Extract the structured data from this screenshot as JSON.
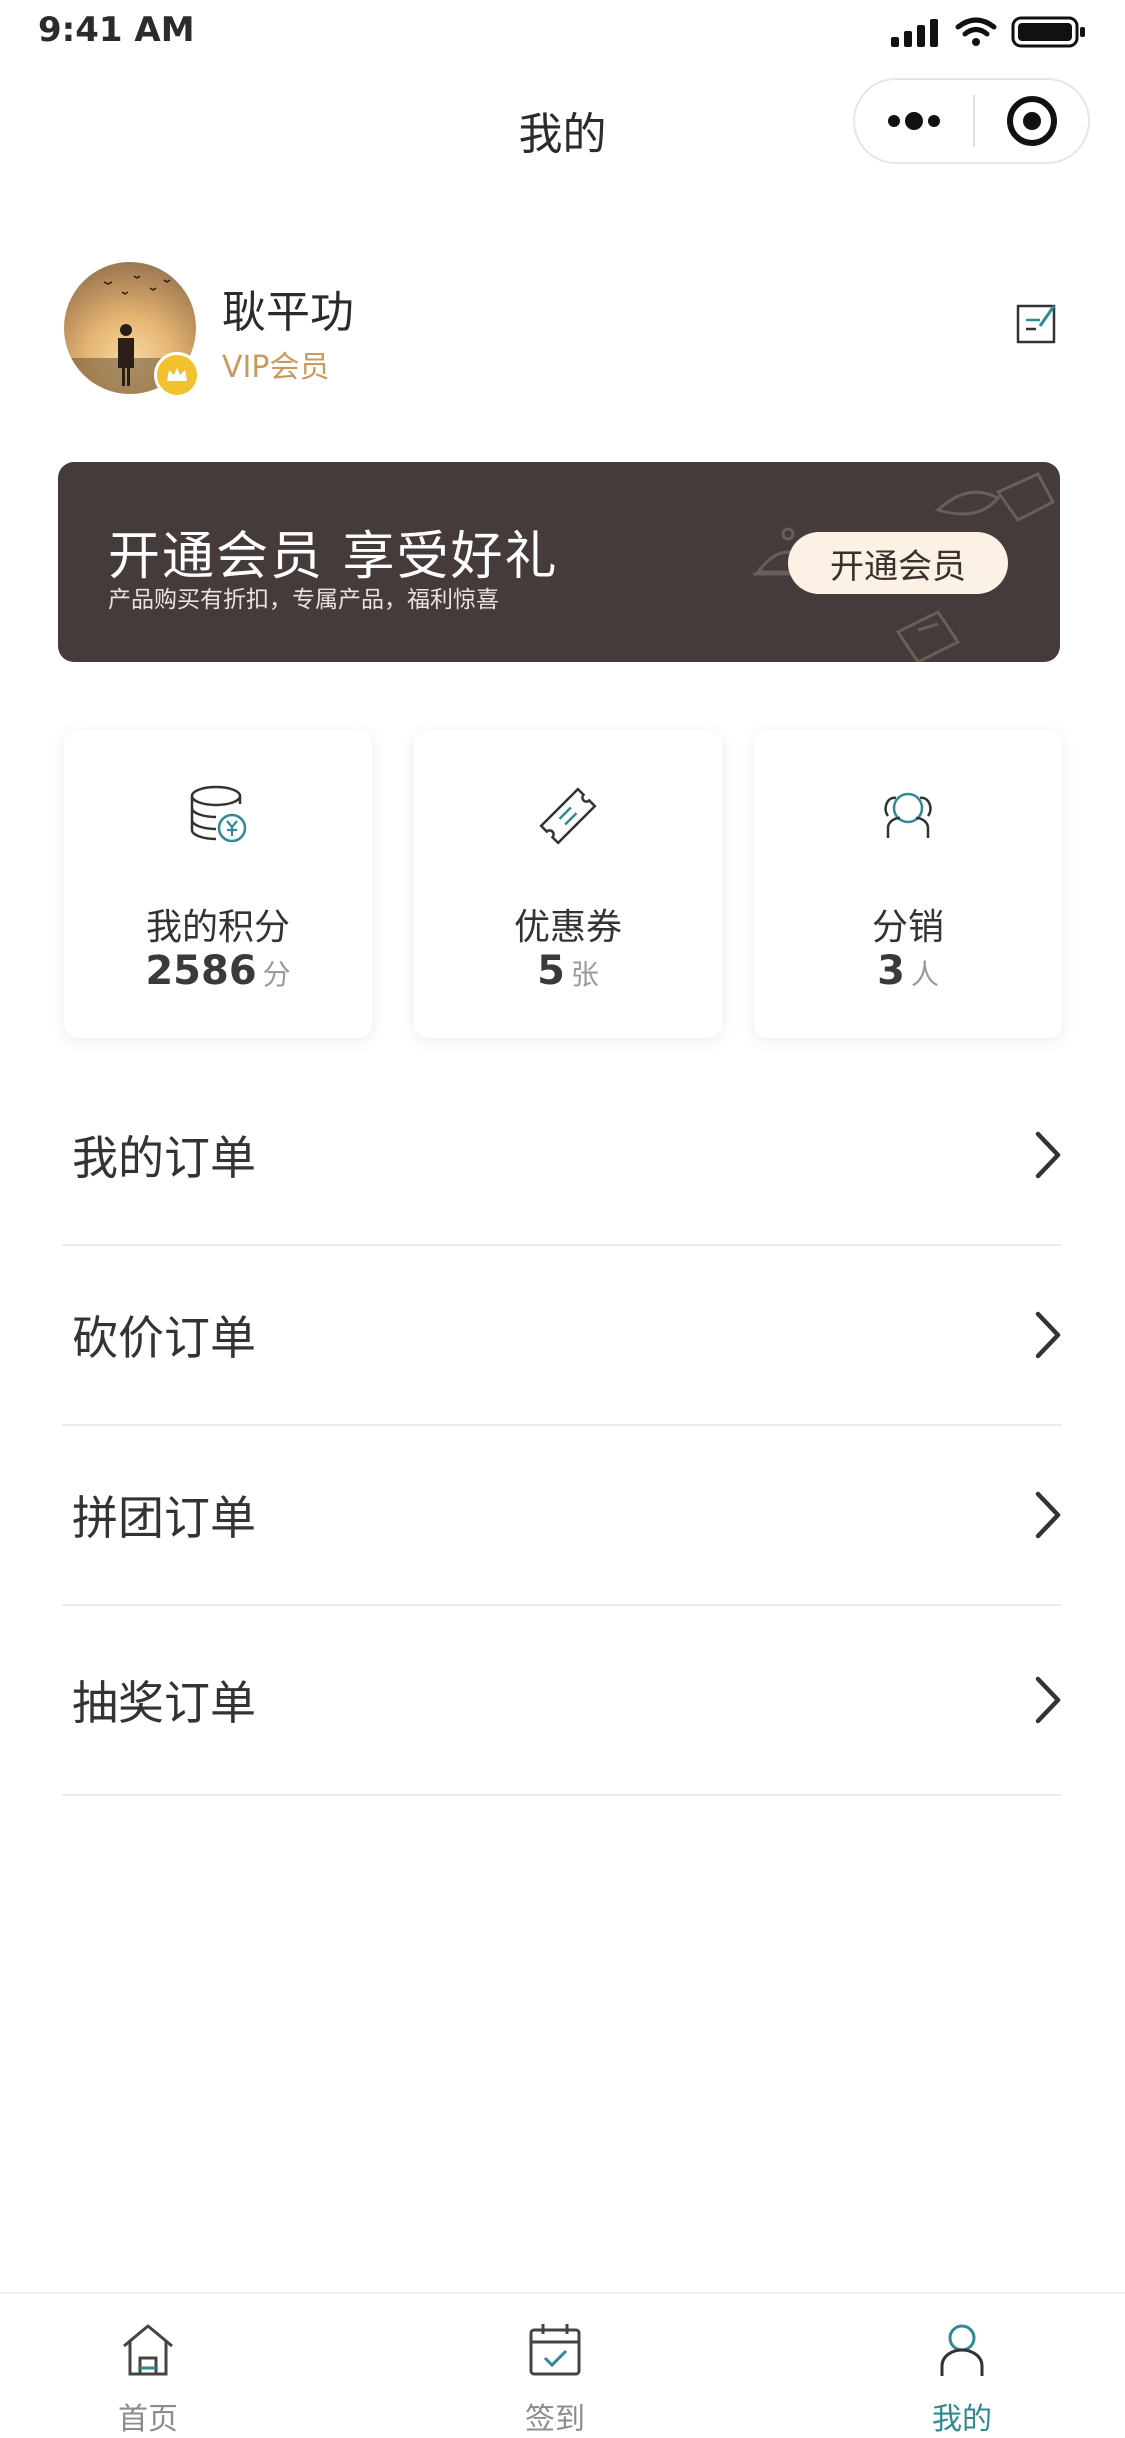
{
  "status_bar": {
    "time": "9:41 AM"
  },
  "header": {
    "title": "我的"
  },
  "profile": {
    "name": "耿平功",
    "badge": "VIP会员"
  },
  "vip_banner": {
    "title": "开通会员 享受好礼",
    "subtitle": "产品购买有折扣，专属产品，福利惊喜",
    "button_label": "开通会员"
  },
  "stats": [
    {
      "label": "我的积分",
      "value": "2586",
      "unit": "分",
      "icon": "coins-icon"
    },
    {
      "label": "优惠券",
      "value": "5",
      "unit": "张",
      "icon": "coupon-icon"
    },
    {
      "label": "分销",
      "value": "3",
      "unit": "人",
      "icon": "distribution-icon"
    }
  ],
  "menu": [
    {
      "label": "我的订单"
    },
    {
      "label": "砍价订单"
    },
    {
      "label": "拼团订单"
    },
    {
      "label": "抽奖订单"
    }
  ],
  "tabbar": {
    "items": [
      {
        "label": "首页",
        "icon": "home-icon"
      },
      {
        "label": "签到",
        "icon": "calendar-check-icon"
      },
      {
        "label": "我的",
        "icon": "user-icon",
        "active": true
      }
    ]
  },
  "colors": {
    "accent": "#2f8a92",
    "banner_bg": "#453b3a",
    "vip_gold": "#c99a5c"
  }
}
